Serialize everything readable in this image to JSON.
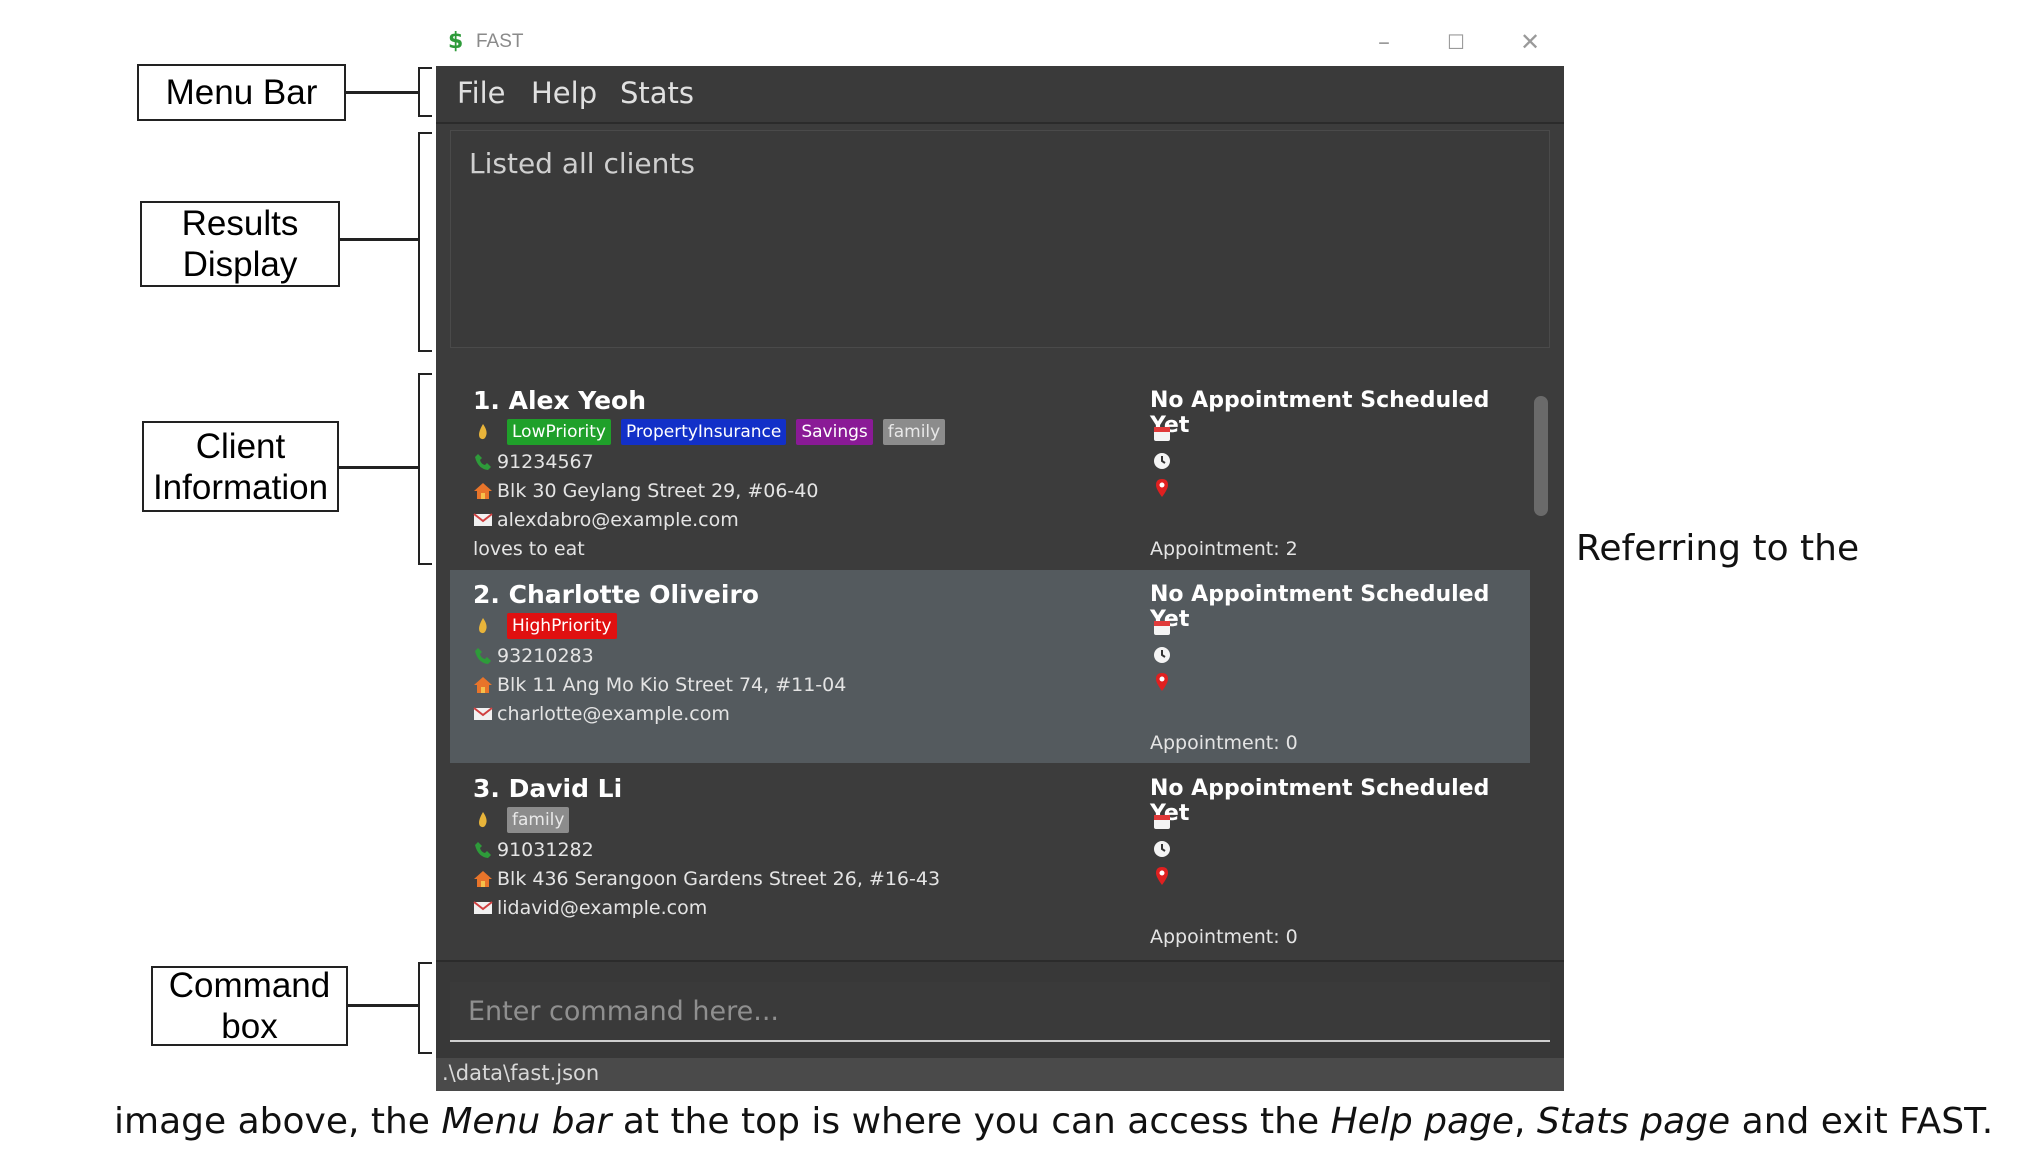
{
  "annotations": {
    "menu_bar": "Menu Bar",
    "results_display": [
      "Results",
      "Display"
    ],
    "client_information": [
      "Client",
      "Information"
    ],
    "command_box": [
      "Command",
      "box"
    ]
  },
  "window": {
    "title": "FAST",
    "menu": [
      "File",
      "Help",
      "Stats"
    ],
    "results_text": "Listed all clients",
    "command_placeholder": "Enter command here...",
    "status_path": ".\\data\\fast.json"
  },
  "clients": [
    {
      "index_name": "1.  Alex Yeoh",
      "tags": [
        {
          "label": "LowPriority",
          "kind": "low"
        },
        {
          "label": "PropertyInsurance",
          "kind": "prop"
        },
        {
          "label": "Savings",
          "kind": "sav"
        },
        {
          "label": "family",
          "kind": "fam"
        }
      ],
      "phone": "91234567",
      "address": "Blk 30 Geylang Street 29, #06-40",
      "email": "alexdabro@example.com",
      "remark": "loves to eat",
      "appointment_status": "No Appointment Scheduled Yet",
      "appointment_count": "Appointment: 2",
      "selected": false
    },
    {
      "index_name": "2.  Charlotte Oliveiro",
      "tags": [
        {
          "label": "HighPriority",
          "kind": "high"
        }
      ],
      "phone": "93210283",
      "address": "Blk 11 Ang Mo Kio Street 74, #11-04",
      "email": "charlotte@example.com",
      "remark": "",
      "appointment_status": "No Appointment Scheduled Yet",
      "appointment_count": "Appointment: 0",
      "selected": true
    },
    {
      "index_name": "3.  David Li",
      "tags": [
        {
          "label": "family",
          "kind": "fam"
        }
      ],
      "phone": "91031282",
      "address": "Blk 436 Serangoon Gardens Street 26, #16-43",
      "email": "lidavid@example.com",
      "remark": "",
      "appointment_status": "No Appointment Scheduled Yet",
      "appointment_count": "Appointment: 0",
      "selected": false
    }
  ],
  "doc_text": {
    "side": "Referring to the",
    "bottom_parts": [
      {
        "t": "image above, the ",
        "i": false
      },
      {
        "t": "Menu bar",
        "i": true
      },
      {
        "t": " at the top is where you can access the ",
        "i": false
      },
      {
        "t": "Help page",
        "i": true
      },
      {
        "t": ", ",
        "i": false
      },
      {
        "t": "Stats page",
        "i": true
      },
      {
        "t": " and exit FAST.",
        "i": false
      }
    ]
  },
  "colors": {
    "low_priority": "#1fa02a",
    "property_insurance": "#1230c8",
    "savings": "#8a1a96",
    "family": "#8c8c8c",
    "high_priority": "#e01010",
    "app_background": "#3c3c3c",
    "selected_card": "#545a5e"
  }
}
